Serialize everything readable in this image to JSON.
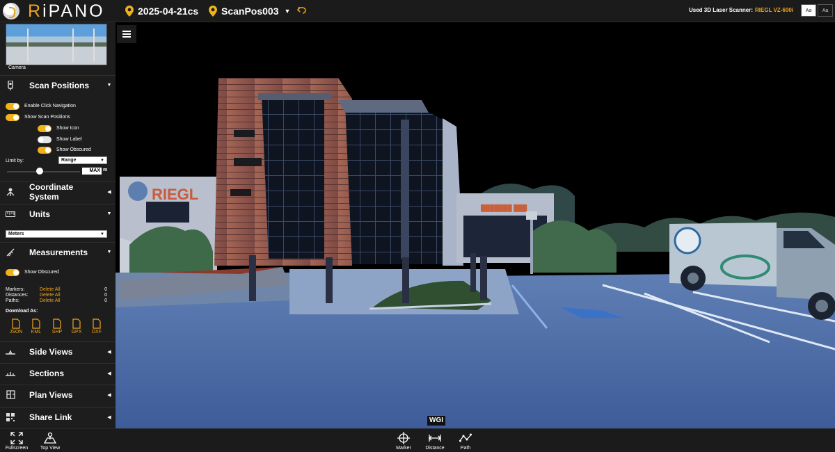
{
  "app": {
    "logo_first": "R",
    "logo_rest": "iPANO",
    "accent": "#f0a51c"
  },
  "header": {
    "date": "2025-04-21cs",
    "scan_position": "ScanPos003",
    "scanner_label": "Used 3D Laser Scanner:",
    "scanner_model": "RIEGL VZ-600i",
    "font_small": "Aa",
    "font_large": "Aa"
  },
  "sidebar": {
    "camera_label": "Camera",
    "scan_positions": {
      "title": "Scan Positions",
      "enable_click_navigation": "Enable Click Navigation",
      "show_scan_positions": "Show Scan Positions",
      "show_icon": "Show Icon",
      "show_label": "Show Label",
      "show_obscured": "Show Obscured",
      "limit_by_label": "Limit by:",
      "limit_by_value": "Range",
      "max_value": "MAX",
      "max_unit": "m"
    },
    "coordinate_system": {
      "title": "Coordinate System"
    },
    "units": {
      "title": "Units",
      "value": "Meters"
    },
    "measurements": {
      "title": "Measurements",
      "show_obscured": "Show Obscured",
      "rows": [
        {
          "label": "Markers:",
          "action": "Delete All",
          "count": "0"
        },
        {
          "label": "Distances:",
          "action": "Delete All",
          "count": "0"
        },
        {
          "label": "Paths:",
          "action": "Delete All",
          "count": "0"
        }
      ],
      "download_label": "Download As:",
      "formats": [
        "JSON",
        "KML",
        "SHP",
        "GPX",
        "DXF"
      ]
    },
    "side_views": {
      "title": "Side Views"
    },
    "sections": {
      "title": "Sections"
    },
    "plan_views": {
      "title": "Plan Views"
    },
    "share_link": {
      "title": "Share Link"
    }
  },
  "viewport": {
    "scene_label": "WGI",
    "sign_text": "RIEGL"
  },
  "bottom_tools": {
    "fullscreen": "Fullscreen",
    "top_view": "Top View",
    "marker": "Marker",
    "distance": "Distance",
    "path": "Path"
  }
}
